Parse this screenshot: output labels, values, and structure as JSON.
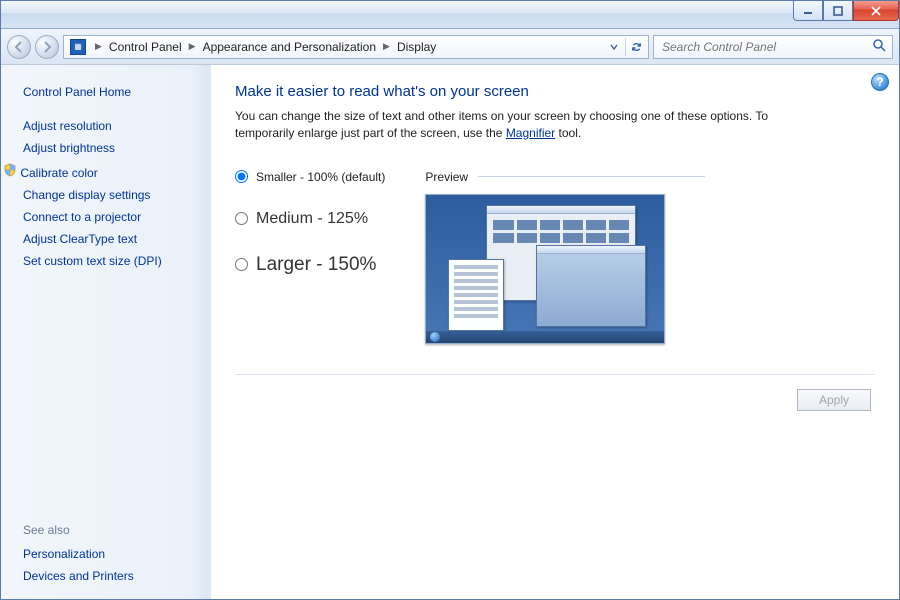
{
  "titlebar": {
    "title": ""
  },
  "wincontrols": {
    "min": "—",
    "max": "◻",
    "close": "✕"
  },
  "address": {
    "crumbs": [
      "Control Panel",
      "Appearance and Personalization",
      "Display"
    ]
  },
  "search": {
    "placeholder": "Search Control Panel"
  },
  "sidebar": {
    "home": "Control Panel Home",
    "links": [
      {
        "label": "Adjust resolution",
        "shield": false
      },
      {
        "label": "Adjust brightness",
        "shield": false
      },
      {
        "label": "Calibrate color",
        "shield": true
      },
      {
        "label": "Change display settings",
        "shield": false
      },
      {
        "label": "Connect to a projector",
        "shield": false
      },
      {
        "label": "Adjust ClearType text",
        "shield": false
      },
      {
        "label": "Set custom text size (DPI)",
        "shield": false
      }
    ],
    "seealso_label": "See also",
    "seealso_links": [
      "Personalization",
      "Devices and Printers"
    ]
  },
  "main": {
    "title": "Make it easier to read what's on your screen",
    "desc_before": "You can change the size of text and other items on your screen by choosing one of these options. To temporarily enlarge just part of the screen, use the ",
    "desc_link": "Magnifier",
    "desc_after": " tool.",
    "options": [
      {
        "label": "Smaller - 100% (default)",
        "size": "sm",
        "selected": true
      },
      {
        "label": "Medium - 125%",
        "size": "med",
        "selected": false
      },
      {
        "label": "Larger - 150%",
        "size": "lrg",
        "selected": false
      }
    ],
    "preview_label": "Preview",
    "apply_label": "Apply"
  },
  "help": "?"
}
